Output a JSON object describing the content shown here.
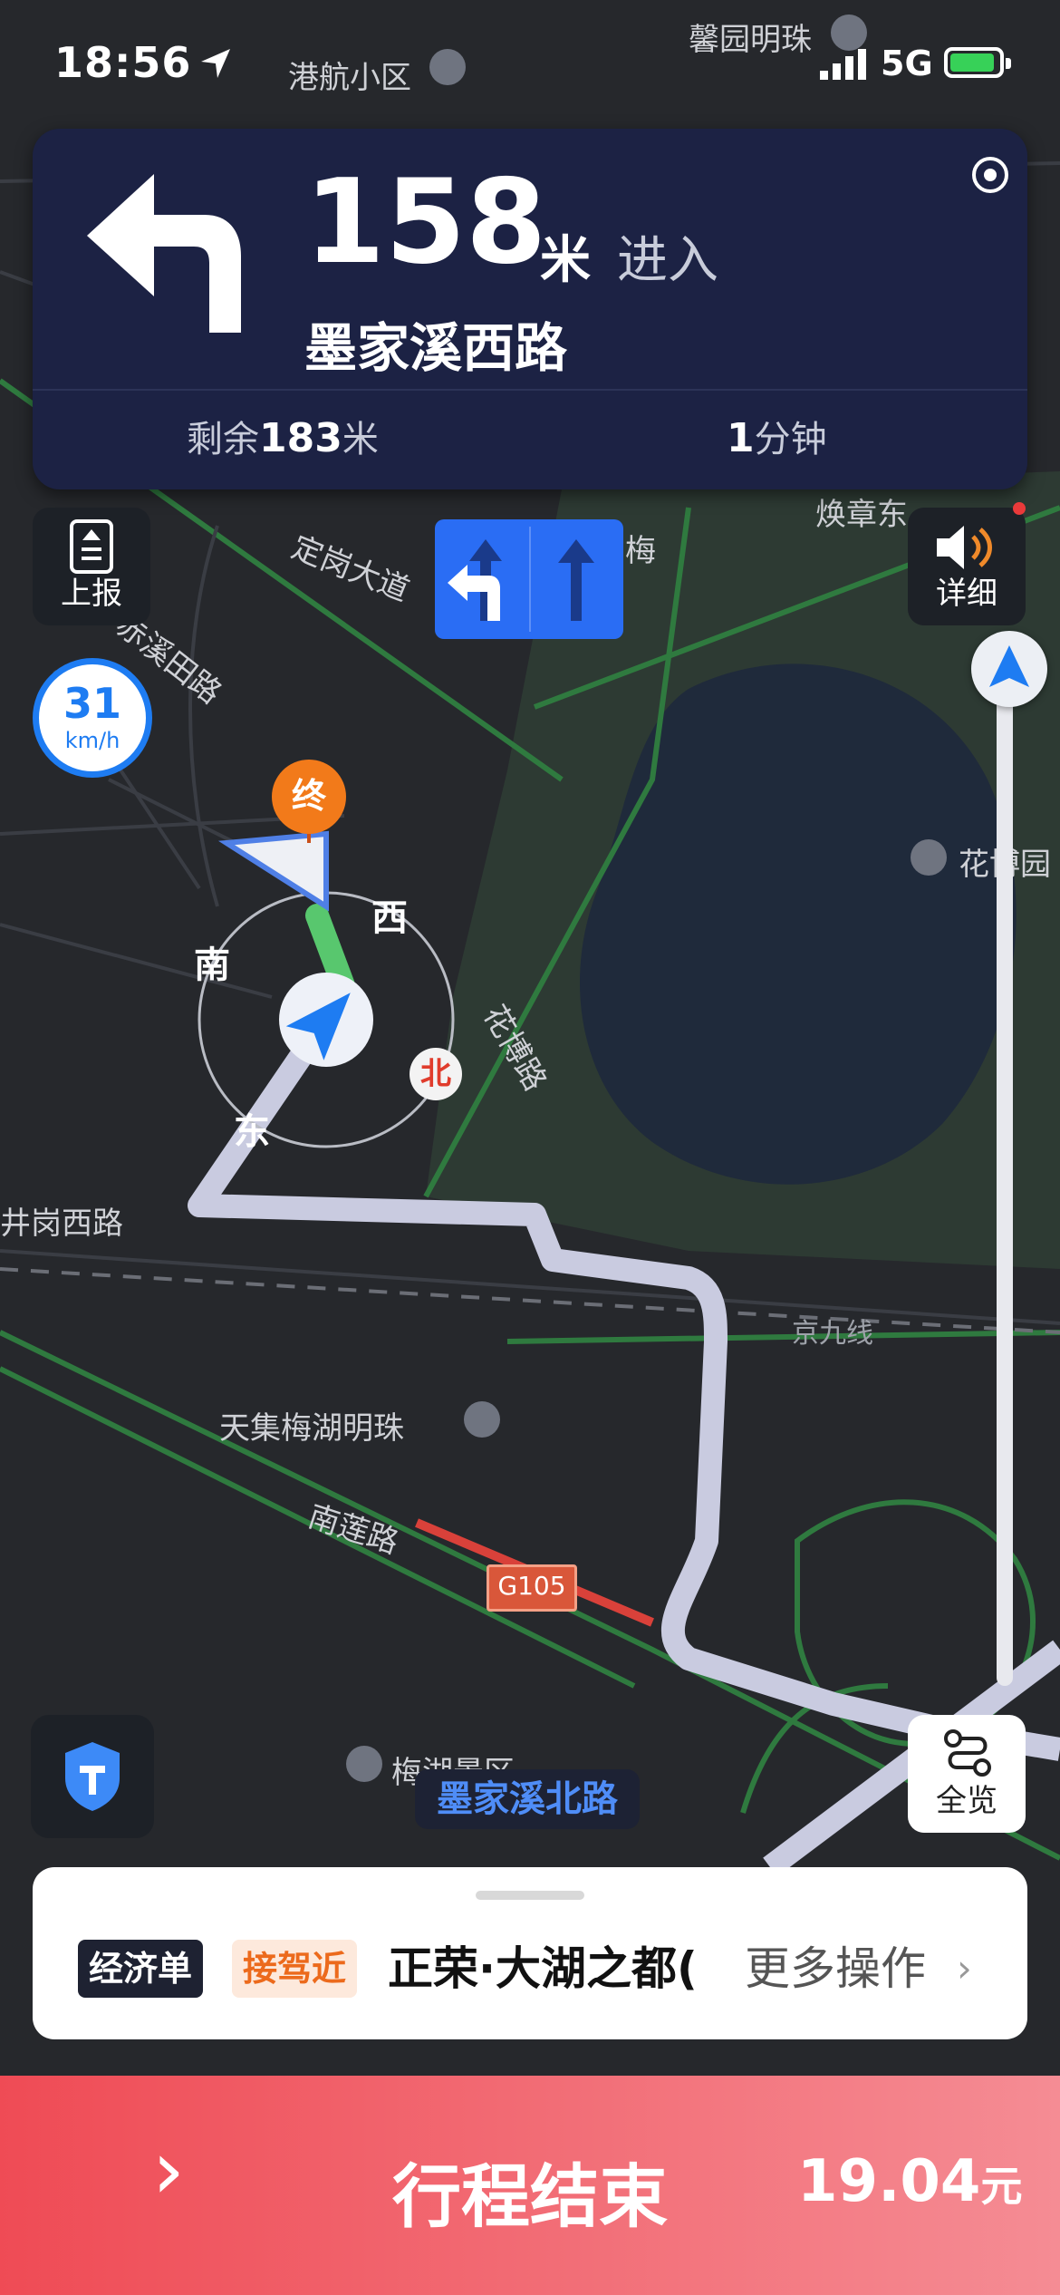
{
  "status_bar": {
    "time": "18:56",
    "network": "5G"
  },
  "nav_card": {
    "distance_value": "158",
    "distance_unit": "米",
    "action": "进入",
    "road": "墨家溪西路",
    "remaining_prefix": "剩余",
    "remaining_value": "183",
    "remaining_unit": "米",
    "eta_value": "1",
    "eta_unit": "分钟"
  },
  "controls": {
    "report_label": "上报",
    "speed_value": "31",
    "speed_unit": "km/h",
    "detail_label": "详细",
    "overview_label": "全览"
  },
  "map": {
    "labels": {
      "top_poi": "港航小区",
      "top_poi2": "馨园明珠",
      "r1": "定岗大道",
      "r2": "焕章东",
      "r3": "梅",
      "r4": "赤溪田路",
      "r5": "花博园",
      "r6": "花博路",
      "r7": "井岗西路",
      "r8": "京九线",
      "r9": "天集梅湖明珠",
      "r10": "南莲路",
      "r11": "梅湖景区"
    },
    "compass": {
      "west": "西",
      "south": "南",
      "east": "东",
      "north": "北"
    },
    "destination_marker": "终",
    "highway_shield": "G105",
    "current_road": "墨家溪北路"
  },
  "order_card": {
    "tag_economy": "经济单",
    "tag_pickup": "接驾近",
    "destination": "正荣·大湖之都(",
    "more_actions": "更多操作"
  },
  "end_bar": {
    "label": "行程结束",
    "fare_value": "19.04",
    "fare_unit": "元"
  },
  "colors": {
    "nav_bg": "#1c2244",
    "route": "#c9cbe0",
    "passed_route": "#58c76e",
    "accent_blue": "#1e7cf2",
    "end_bar": "#ef4b55"
  }
}
